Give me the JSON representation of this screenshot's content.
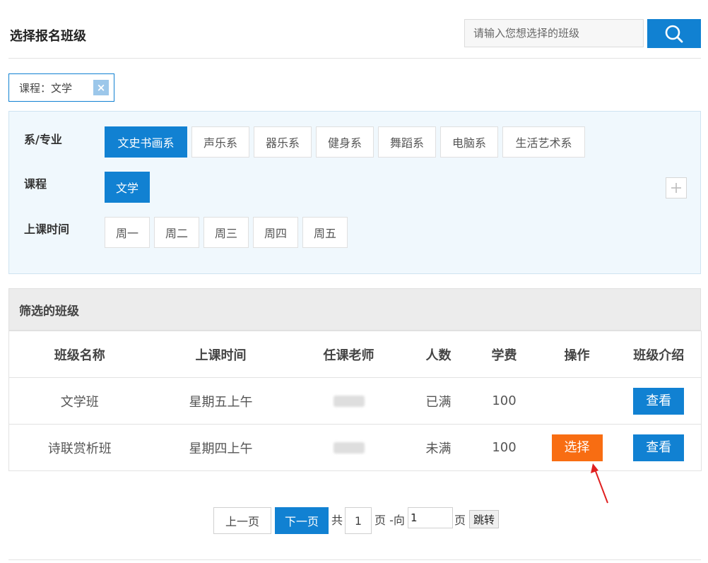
{
  "header": {
    "title": "选择报名班级",
    "search_placeholder": "请输入您想选择的班级",
    "search_icon": "search-icon",
    "accent_color": "#1181d2"
  },
  "active_filter": {
    "label": "课程：文学",
    "close_symbol": "×"
  },
  "filters": {
    "department": {
      "label": "系/专业",
      "options": [
        "文史书画系",
        "声乐系",
        "器乐系",
        "健身系",
        "舞蹈系",
        "电脑系",
        "生活艺术系"
      ],
      "selected": "文史书画系"
    },
    "course": {
      "label": "课程",
      "options": [
        "文学"
      ],
      "selected": "文学"
    },
    "time": {
      "label": "上课时间",
      "options": [
        "周一",
        "周二",
        "周三",
        "周四",
        "周五"
      ]
    },
    "expand_icon": "plus-icon"
  },
  "results": {
    "title": "筛选的班级",
    "columns": [
      "班级名称",
      "上课时间",
      "任课老师",
      "人数",
      "学费",
      "操作",
      "班级介绍"
    ],
    "rows": [
      {
        "name": "文学班",
        "time": "星期五上午",
        "status": "已满",
        "fee": "100",
        "action": "",
        "detail": "查看"
      },
      {
        "name": "诗联赏析班",
        "time": "星期四上午",
        "status": "未满",
        "fee": "100",
        "action": "选择",
        "detail": "查看"
      }
    ],
    "highlight_color": "#ef6a14",
    "select_button_color": "#f86d12"
  },
  "pagination": {
    "prev": "上一页",
    "next": "下一页",
    "total_prefix": "共",
    "total_pages": "1",
    "goto_text": "页 -向",
    "goto_value": "1",
    "page_suffix": "页",
    "jump": "跳转"
  }
}
